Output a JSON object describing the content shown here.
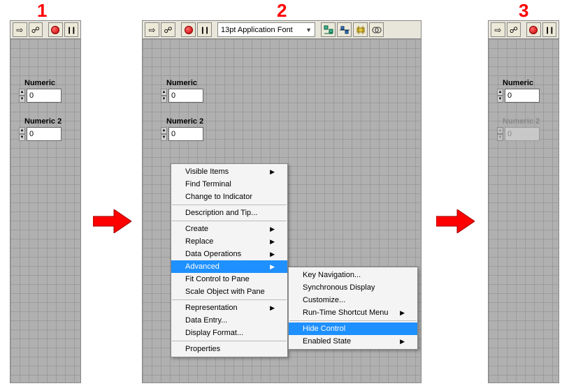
{
  "steps": {
    "s1": "1",
    "s2": "2",
    "s3": "3"
  },
  "toolbar": {
    "font": "13pt Application Font",
    "run_glyph": "⇨",
    "run_cont_glyph": "☍",
    "pause_glyph": "❙❙"
  },
  "controls": {
    "numeric_label": "Numeric",
    "numeric_value": "0",
    "numeric2_label": "Numeric 2",
    "numeric2_value": "0"
  },
  "menu1": {
    "items": [
      {
        "label": "Visible Items",
        "sub": true
      },
      {
        "label": "Find Terminal"
      },
      {
        "label": "Change to Indicator"
      }
    ],
    "items_b": [
      {
        "label": "Description and Tip..."
      }
    ],
    "items_c": [
      {
        "label": "Create",
        "sub": true
      },
      {
        "label": "Replace",
        "sub": true
      },
      {
        "label": "Data Operations",
        "sub": true
      },
      {
        "label": "Advanced",
        "sub": true,
        "hl": true
      },
      {
        "label": "Fit Control to Pane"
      },
      {
        "label": "Scale Object with Pane"
      }
    ],
    "items_d": [
      {
        "label": "Representation",
        "sub": true
      },
      {
        "label": "Data Entry..."
      },
      {
        "label": "Display Format..."
      }
    ],
    "items_e": [
      {
        "label": "Properties"
      }
    ]
  },
  "menu2": {
    "items": [
      {
        "label": "Key Navigation..."
      },
      {
        "label": "Synchronous Display"
      },
      {
        "label": "Customize..."
      },
      {
        "label": "Run-Time Shortcut Menu",
        "sub": true
      }
    ],
    "items_b": [
      {
        "label": "Hide Control",
        "hl": true
      },
      {
        "label": "Enabled State",
        "sub": true
      }
    ]
  }
}
